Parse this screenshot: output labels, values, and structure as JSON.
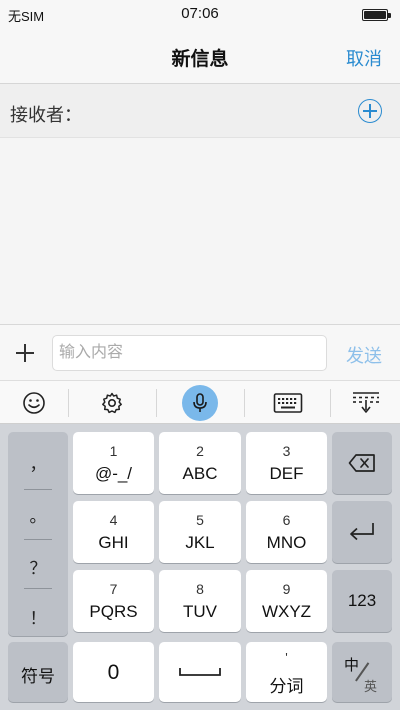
{
  "status_bar": {
    "carrier": "无SIM",
    "time": "07:06"
  },
  "nav": {
    "title": "新信息",
    "cancel": "取消"
  },
  "recipient": {
    "label": "接收者："
  },
  "compose": {
    "placeholder": "输入内容",
    "send": "发送"
  },
  "toolbar": {
    "items": [
      "emoji-icon",
      "settings-icon",
      "microphone-icon",
      "keyboard-icon",
      "hide-keyboard-icon"
    ],
    "active": "microphone-icon",
    "accent": "#7ab8ea"
  },
  "keyboard": {
    "punctuation": [
      "，",
      "。",
      "？",
      "！"
    ],
    "keys": [
      {
        "num": "1",
        "letters": "@-_/"
      },
      {
        "num": "2",
        "letters": "ABC"
      },
      {
        "num": "3",
        "letters": "DEF"
      },
      {
        "num": "4",
        "letters": "GHI"
      },
      {
        "num": "5",
        "letters": "JKL"
      },
      {
        "num": "6",
        "letters": "MNO"
      },
      {
        "num": "7",
        "letters": "PQRS"
      },
      {
        "num": "8",
        "letters": "TUV"
      },
      {
        "num": "9",
        "letters": "WXYZ"
      }
    ],
    "symbols": "符号",
    "zero": "0",
    "apostrophe": "'",
    "segment": "分词",
    "numbers": "123",
    "lang_zh": "中",
    "lang_en": "英",
    "side_icons": [
      "backspace-icon",
      "enter-icon"
    ]
  }
}
